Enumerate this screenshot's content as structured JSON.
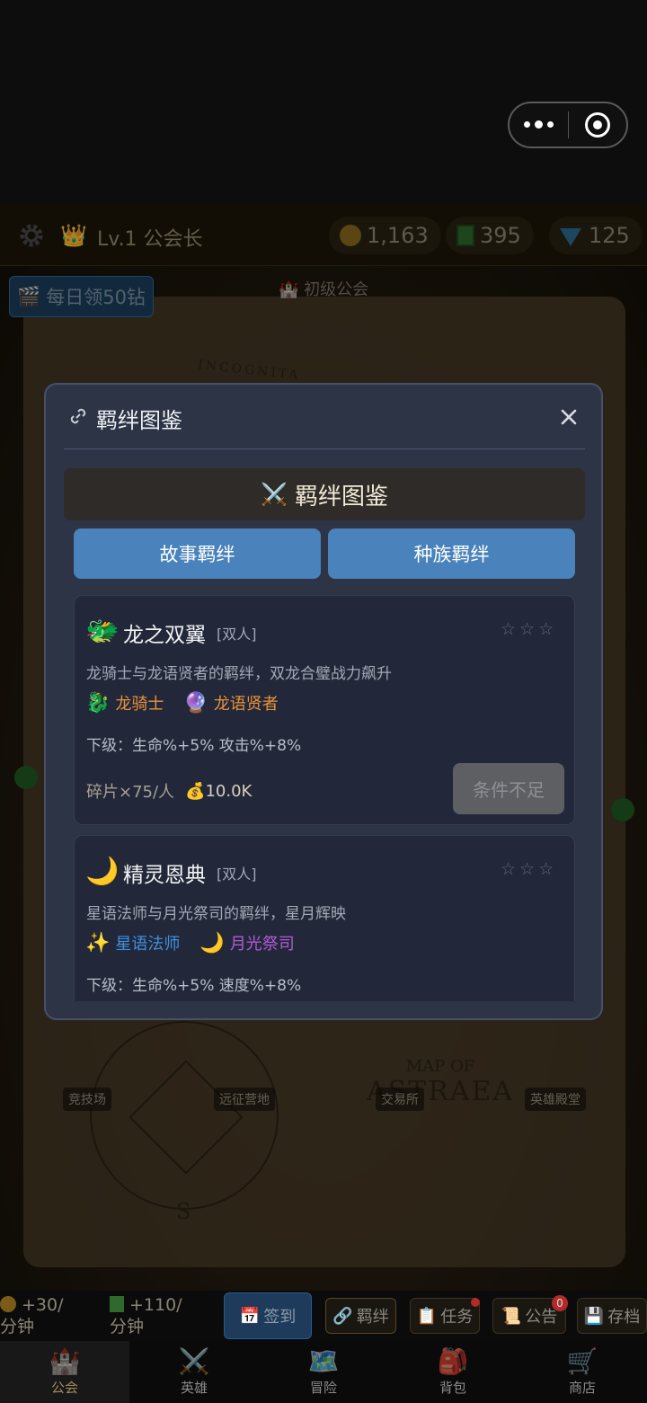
{
  "capsule": {
    "more_icon": "more-dots-icon",
    "close_icon": "target-icon"
  },
  "header": {
    "level_title": "Lv.1 公会长",
    "gold": "1,163",
    "books": "395",
    "gems": "125"
  },
  "map": {
    "daily_reward": "每日领50钻",
    "guild_tier": "初级公会",
    "map_caption": "INCOGNITA",
    "map_title_small": "MAP OF",
    "map_title_big": "ASTRAEA",
    "compass_letter": "S",
    "locations": [
      "竞技场",
      "远征营地",
      "交易所",
      "英雄殿堂"
    ]
  },
  "modal": {
    "title": "羁绊图鉴",
    "banner": "羁绊图鉴",
    "tabs": [
      "故事羁绊",
      "种族羁绊"
    ],
    "bonds": [
      {
        "emoji": "🐲",
        "name": "龙之双翼",
        "type": "[双人]",
        "stars": "☆☆☆",
        "desc": "龙骑士与龙语贤者的羁绊，双龙合璧战力飙升",
        "members": [
          {
            "emoji": "🐉",
            "name": "龙骑士"
          },
          {
            "emoji": "🔮",
            "name": "龙语贤者"
          }
        ],
        "bonus": "下级：生命%+5%  攻击%+8%",
        "shards": "碎片×75/人",
        "money": "💰10.0K",
        "button": "条件不足"
      },
      {
        "emoji": "🌙",
        "name": "精灵恩典",
        "type": "[双人]",
        "stars": "☆☆☆",
        "desc": "星语法师与月光祭司的羁绊，星月辉映",
        "members": [
          {
            "emoji": "✨",
            "name": "星语法师"
          },
          {
            "emoji": "🌙",
            "name": "月光祭司"
          }
        ],
        "bonus": "下级：生命%+5%  速度%+8%"
      }
    ]
  },
  "bottom_bar": {
    "gold_rate_line1": "+30/",
    "gold_rate_line2": "分钟",
    "book_rate_line1": "+110/",
    "book_rate_line2": "分钟",
    "sign": "签到",
    "bond": "羁绊",
    "task": "任务",
    "notice": "公告",
    "notice_badge": "0",
    "save": "存档"
  },
  "nav": [
    {
      "label": "公会",
      "icon": "castle-icon"
    },
    {
      "label": "英雄",
      "icon": "crossed-swords-icon"
    },
    {
      "label": "冒险",
      "icon": "map-icon"
    },
    {
      "label": "背包",
      "icon": "backpack-icon"
    },
    {
      "label": "商店",
      "icon": "cart-icon"
    }
  ],
  "colors": {
    "modal_bg": "#2c3446",
    "tab_blue": "#4a82bb",
    "member_orange": "#e8923a",
    "member_blue": "#3f8fe0",
    "member_purple": "#b25ad6"
  }
}
